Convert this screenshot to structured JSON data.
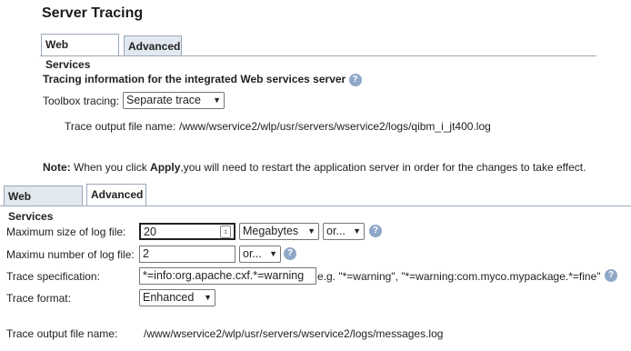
{
  "page": {
    "title": "Server Tracing"
  },
  "tabs_top": {
    "web_services": "Web Services",
    "advanced": "Advanced"
  },
  "web_services_panel": {
    "heading": "Tracing information for the integrated Web services server",
    "toolbox_label": "Toolbox tracing:",
    "toolbox_value": "Separate trace",
    "output_label": "Trace output file name:",
    "output_value": "/www/wservice2/wlp/usr/servers/wservice2/logs/qibm_i_jt400.log",
    "note_prefix": "Note:",
    "note_text_1": " When you click ",
    "note_apply": "Apply",
    "note_text_2": ",you will need to restart the application server in order for the changes to take effect."
  },
  "tabs_bottom": {
    "web_services": "Web Services",
    "advanced": "Advanced"
  },
  "advanced_panel": {
    "max_size_label": "Maximum size of log file:",
    "max_size_value": "20",
    "max_size_unit": "Megabytes",
    "max_size_or": "or...",
    "max_number_label": "Maximu number of log file:",
    "max_number_value": "2",
    "max_number_or": "or...",
    "trace_spec_label": "Trace specification:",
    "trace_spec_value": "*=info:org.apache.cxf.*=warning",
    "trace_spec_hint": "e.g. \"*=warning\", \"*=warning:com.myco.mypackage.*=fine\"",
    "trace_format_label": "Trace format:",
    "trace_format_value": "Enhanced",
    "output_label": "Trace output file name:",
    "output_value": "/www/wservice2/wlp/usr/servers/wservice2/logs/messages.log"
  },
  "icons": {
    "help": "help-icon",
    "dropdown": "chevron-down-icon",
    "spin": "stepper-icon"
  },
  "colors": {
    "tab_inactive": "#e2e8f0",
    "help": "#8fa8c8",
    "border": "#9aa8b8"
  }
}
